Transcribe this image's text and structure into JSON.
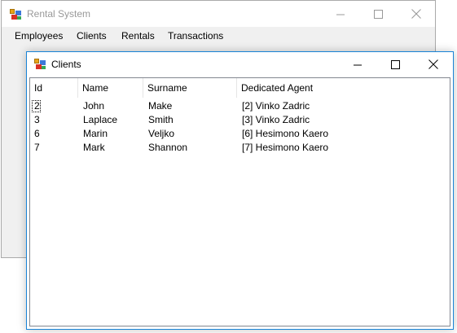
{
  "main_window": {
    "title": "Rental System",
    "menu": {
      "employees": "Employees",
      "clients": "Clients",
      "rentals": "Rentals",
      "transactions": "Transactions"
    }
  },
  "clients_window": {
    "title": "Clients",
    "columns": {
      "id": "Id",
      "name": "Name",
      "surname": "Surname",
      "agent": "Dedicated Agent"
    },
    "rows": [
      {
        "id": "2",
        "name": "John",
        "surname": "Make",
        "agent": "[2] Vinko Zadric"
      },
      {
        "id": "3",
        "name": "Laplace",
        "surname": "Smith",
        "agent": "[3] Vinko Zadric"
      },
      {
        "id": "6",
        "name": "Marin",
        "surname": "Veljko",
        "agent": "[6] Hesimono Kaero"
      },
      {
        "id": "7",
        "name": "Mark",
        "surname": "Shannon",
        "agent": "[7] Hesimono Kaero"
      }
    ]
  },
  "colors": {
    "active_border": "#1883d7",
    "inactive_title_text": "#999999",
    "window_background": "#f0f0f0"
  },
  "icons": {
    "app": "app-icon",
    "minimize": "minimize-icon",
    "maximize": "maximize-icon",
    "close": "close-icon"
  }
}
